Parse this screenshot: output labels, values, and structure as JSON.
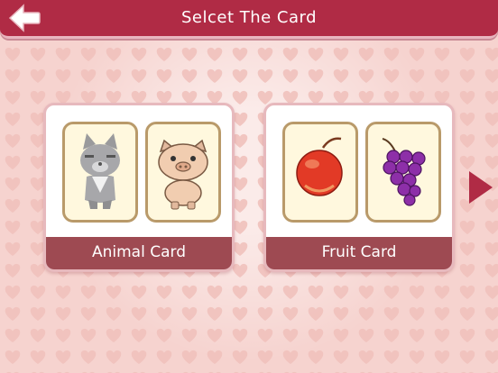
{
  "header": {
    "title": "Selcet The Card"
  },
  "panels": [
    {
      "label": "Animal Card",
      "cards": [
        "cat-icon",
        "pig-icon"
      ]
    },
    {
      "label": "Fruit Card",
      "cards": [
        "apple-icon",
        "grapes-icon"
      ]
    }
  ],
  "colors": {
    "header": "#b02b45",
    "panel_label": "#9e4a52",
    "card_face": "#fff8de",
    "next_arrow": "#b02b45"
  }
}
